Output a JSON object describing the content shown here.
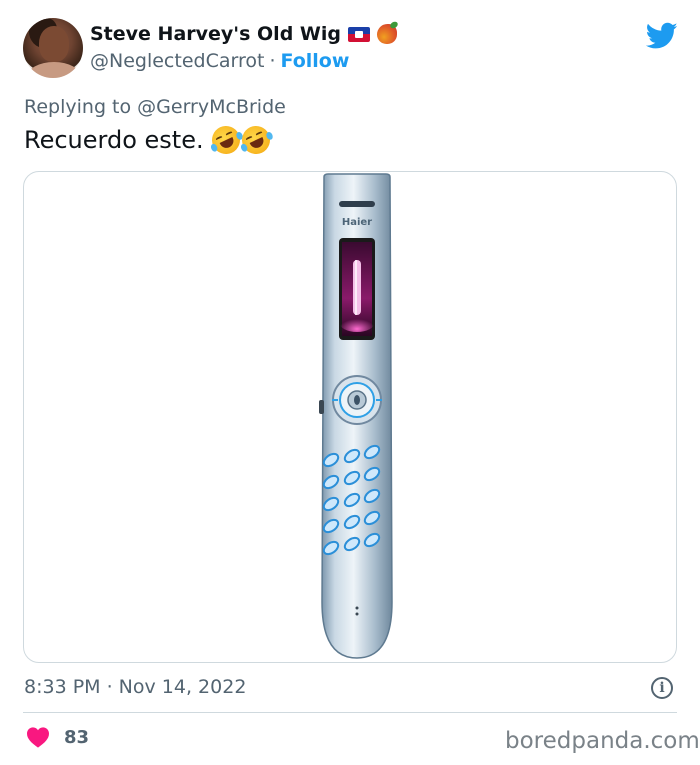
{
  "author": {
    "display_name": "Steve Harvey's Old Wig",
    "handle": "@NeglectedCarrot",
    "separator": "·",
    "follow_label": "Follow",
    "badges": [
      "haiti-flag-icon",
      "mango-icon"
    ]
  },
  "reply": {
    "prefix": "Replying to",
    "mention": "@GerryMcBride"
  },
  "tweet": {
    "text": "Recuerdo este.",
    "emojis": [
      "rolling-on-floor-laughing",
      "rolling-on-floor-laughing"
    ]
  },
  "media": {
    "brand_text": "Haier"
  },
  "meta": {
    "timestamp": "8:33 PM · Nov 14, 2022"
  },
  "engagement": {
    "likes": "83"
  },
  "watermark": "boredpanda.com",
  "colors": {
    "accent": "#1d9bf0",
    "text_primary": "#0f1419",
    "text_secondary": "#536471",
    "heart": "#f91880",
    "border": "#cfd9de"
  }
}
